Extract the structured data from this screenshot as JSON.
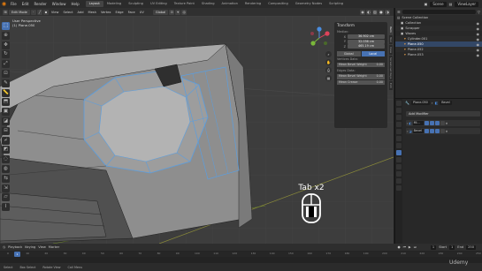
{
  "topbar": {
    "menus": [
      "File",
      "Edit",
      "Render",
      "Window",
      "Help"
    ],
    "workspaces": [
      "Layout",
      "Modeling",
      "Sculpting",
      "UV Editing",
      "Texture Paint",
      "Shading",
      "Animation",
      "Rendering",
      "Compositing",
      "Geometry Nodes",
      "Scripting"
    ],
    "active_workspace": "Layout",
    "scene": "Scene",
    "view_layer": "ViewLayer"
  },
  "viewport_header": {
    "mode": "Edit Mode",
    "menus": [
      "View",
      "Select",
      "Add",
      "Mesh",
      "Vertex",
      "Edge",
      "Face",
      "UV"
    ],
    "orientation": "Global",
    "options": "Options"
  },
  "viewport": {
    "view_name": "User Perspective",
    "object_info": "(1) Plane.050"
  },
  "npanel": {
    "title": "Transform",
    "median_label": "Median:",
    "fields": [
      {
        "label": "X",
        "value": "36.902 cm"
      },
      {
        "label": "Y",
        "value": "32.036 cm"
      },
      {
        "label": "Z",
        "value": "465.19 cm"
      }
    ],
    "space": [
      "Global",
      "Local"
    ],
    "space_active": "Local",
    "vertices_data_label": "Vertices Data:",
    "vertex_fields": [
      {
        "label": "Mean Bevel Weight",
        "value": "0.00"
      }
    ],
    "edges_data_label": "Edges Data:",
    "edge_fields": [
      {
        "label": "Mean Bevel Weight",
        "value": "0.00"
      },
      {
        "label": "Mean Crease",
        "value": "0.00"
      }
    ],
    "tabs": [
      "Item",
      "Tool",
      "View",
      "Screencast Keys",
      "Edit"
    ]
  },
  "overlay": {
    "key_label": "Tab x2"
  },
  "outliner": {
    "items": [
      {
        "name": "Scene Collection"
      },
      {
        "name": "Collection"
      },
      {
        "name": "Scrapper"
      },
      {
        "name": "Waves"
      },
      {
        "name": "Cylinder.001"
      },
      {
        "name": "Plane.050"
      },
      {
        "name": "Plane.052"
      },
      {
        "name": "Plane.053"
      }
    ]
  },
  "properties": {
    "object": "Plane.050",
    "modifier_name": "Bevel",
    "add_modifier": "Add Modifier",
    "modifiers": [
      {
        "name": "Mi..."
      },
      {
        "name": "Bevel"
      }
    ]
  },
  "timeline": {
    "menus": [
      "Playback",
      "Keying",
      "View",
      "Marker"
    ],
    "current_frame": "1",
    "start_label": "Start",
    "start": "1",
    "end_label": "End",
    "end": "250",
    "ticks": [
      "0",
      "10",
      "20",
      "30",
      "40",
      "50",
      "60",
      "70",
      "80",
      "90",
      "100",
      "110",
      "120",
      "130",
      "140",
      "150",
      "160",
      "170",
      "180",
      "190",
      "200",
      "210",
      "220",
      "230",
      "240",
      "250"
    ]
  },
  "statusbar": {
    "items": [
      "Select",
      "Box Select",
      "Rotate View",
      "Call Menu"
    ]
  },
  "watermark": "Udemy",
  "colors": {
    "accent": "#4772b3",
    "bg": "#1d1d1d",
    "viewport": "#3d3d3d"
  }
}
